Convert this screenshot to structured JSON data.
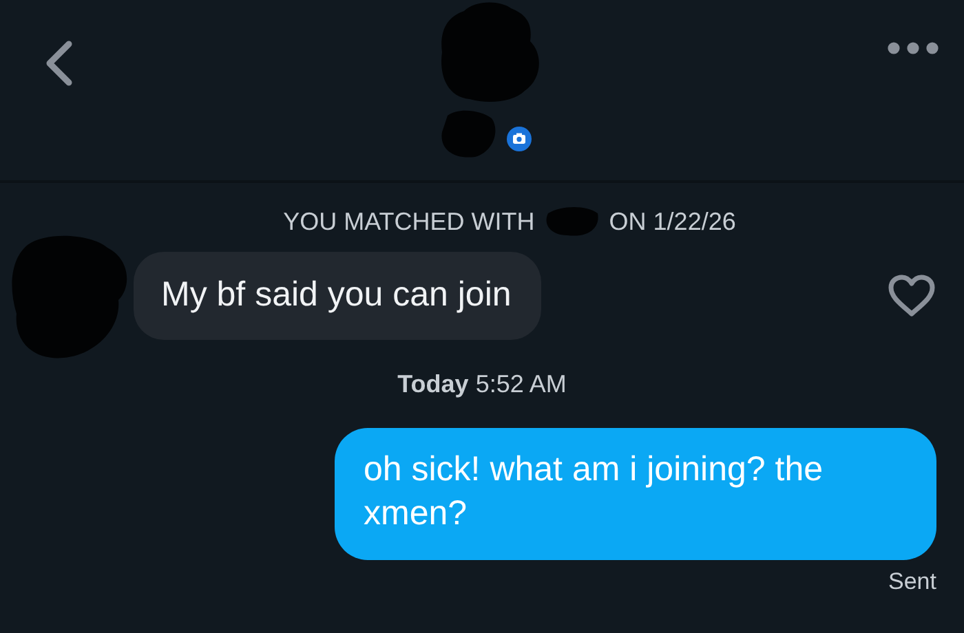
{
  "match_notice": {
    "before": "YOU MATCHED WITH",
    "after": "ON 1/22/26"
  },
  "messages": [
    {
      "kind": "received",
      "text": "My bf said you can join"
    },
    {
      "kind": "timestamp",
      "text": "**Today** 5:52 AM"
    },
    {
      "kind": "sent",
      "text": "oh sick! what am i joining? the xmen?",
      "status": "Sent"
    }
  ]
}
